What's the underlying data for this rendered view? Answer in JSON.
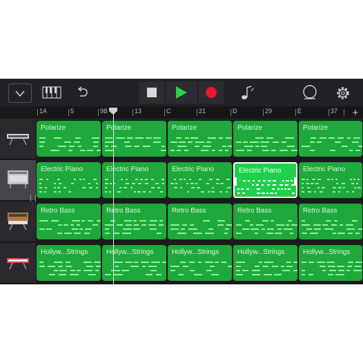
{
  "toolbar": {
    "icons": [
      "tracks-dropdown-icon",
      "keyboard-icon",
      "undo-icon",
      "stop-icon",
      "play-icon",
      "record-icon",
      "metronome-icon",
      "master-effects-icon",
      "settings-gear-icon"
    ],
    "colors": {
      "play": "#2ecf4a",
      "record": "#e8192c"
    }
  },
  "ruler": {
    "labels": [
      "1A",
      "5",
      "9B",
      "13",
      "C",
      "21",
      "D",
      "29",
      "E",
      "37"
    ],
    "add_label": "+"
  },
  "tracks": [
    {
      "instrument_icon": "synth-keyboard-icon",
      "regions": [
        "Polarize",
        "Polarize",
        "Polarize",
        "Polarize",
        "Polarize"
      ]
    },
    {
      "instrument_icon": "electric-piano-icon",
      "regions": [
        "Electric Piano",
        "Electric Piano",
        "Electric Piano",
        "Electric Piano",
        "Electric Piano"
      ],
      "selected_region": 3,
      "selected_header": true
    },
    {
      "instrument_icon": "bass-synth-icon",
      "regions": [
        "Retro Bass",
        "Retro Bass",
        "Retro Bass",
        "Retro Bass",
        "Retro Bass"
      ]
    },
    {
      "instrument_icon": "strings-keyboard-icon",
      "regions": [
        "Hollyw...Strings",
        "Hollyw...Strings",
        "Hollyw...Strings",
        "Hollyw...Strings",
        "Hollyw...Strings"
      ]
    }
  ]
}
